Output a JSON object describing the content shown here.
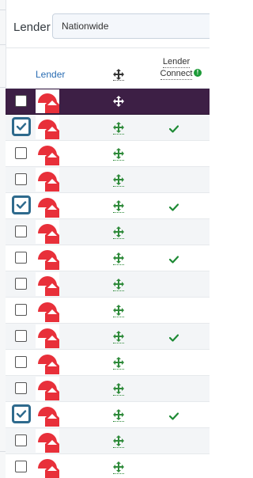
{
  "filter": {
    "label": "Lender",
    "value": "Nationwide"
  },
  "table": {
    "columns": {
      "lender": "Lender",
      "move_icon": "move-icon",
      "connect_line1": "Lender",
      "connect_line2": "Connect",
      "connect_info_icon": "info-icon"
    },
    "rows": [
      {
        "checked": false,
        "connect": false,
        "selected": true
      },
      {
        "checked": true,
        "connect": true,
        "selected": false
      },
      {
        "checked": false,
        "connect": false,
        "selected": false
      },
      {
        "checked": false,
        "connect": false,
        "selected": false
      },
      {
        "checked": true,
        "connect": true,
        "selected": false
      },
      {
        "checked": false,
        "connect": false,
        "selected": false
      },
      {
        "checked": false,
        "connect": true,
        "selected": false
      },
      {
        "checked": false,
        "connect": false,
        "selected": false
      },
      {
        "checked": false,
        "connect": false,
        "selected": false
      },
      {
        "checked": false,
        "connect": true,
        "selected": false
      },
      {
        "checked": false,
        "connect": false,
        "selected": false
      },
      {
        "checked": false,
        "connect": false,
        "selected": false
      },
      {
        "checked": true,
        "connect": true,
        "selected": false
      },
      {
        "checked": false,
        "connect": false,
        "selected": false
      },
      {
        "checked": false,
        "connect": false,
        "selected": false
      }
    ]
  },
  "colors": {
    "accent_blue": "#2a6db3",
    "selected_row": "#3d1f45",
    "checkbox_checked_border": "#2e6a8d",
    "connect_green": "#1d9a38",
    "logo_red": "#e8303a"
  }
}
